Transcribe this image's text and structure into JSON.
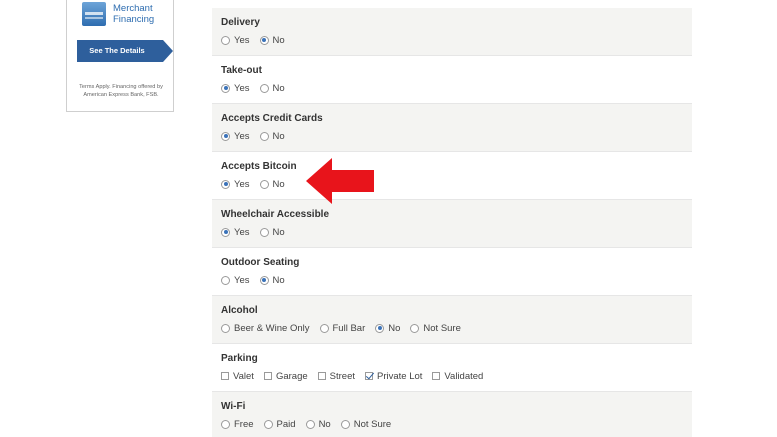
{
  "ad": {
    "brand": "Merchant",
    "brand2": "Financing",
    "cta": "See The Details",
    "terms": "Terms Apply. Financing offered by American Express Bank, FSB."
  },
  "form": {
    "rows": [
      {
        "label": "Delivery",
        "type": "radio",
        "options": [
          {
            "label": "Yes",
            "checked": false
          },
          {
            "label": "No",
            "checked": true
          }
        ]
      },
      {
        "label": "Take-out",
        "type": "radio",
        "options": [
          {
            "label": "Yes",
            "checked": true
          },
          {
            "label": "No",
            "checked": false
          }
        ]
      },
      {
        "label": "Accepts Credit Cards",
        "type": "radio",
        "options": [
          {
            "label": "Yes",
            "checked": true
          },
          {
            "label": "No",
            "checked": false
          }
        ]
      },
      {
        "label": "Accepts Bitcoin",
        "type": "radio",
        "options": [
          {
            "label": "Yes",
            "checked": true
          },
          {
            "label": "No",
            "checked": false
          }
        ]
      },
      {
        "label": "Wheelchair Accessible",
        "type": "radio",
        "options": [
          {
            "label": "Yes",
            "checked": true
          },
          {
            "label": "No",
            "checked": false
          }
        ]
      },
      {
        "label": "Outdoor Seating",
        "type": "radio",
        "options": [
          {
            "label": "Yes",
            "checked": false
          },
          {
            "label": "No",
            "checked": true
          }
        ]
      },
      {
        "label": "Alcohol",
        "type": "radio",
        "options": [
          {
            "label": "Beer & Wine Only",
            "checked": false
          },
          {
            "label": "Full Bar",
            "checked": false
          },
          {
            "label": "No",
            "checked": true
          },
          {
            "label": "Not Sure",
            "checked": false
          }
        ]
      },
      {
        "label": "Parking",
        "type": "checkbox",
        "options": [
          {
            "label": "Valet",
            "checked": false
          },
          {
            "label": "Garage",
            "checked": false
          },
          {
            "label": "Street",
            "checked": false
          },
          {
            "label": "Private Lot",
            "checked": true
          },
          {
            "label": "Validated",
            "checked": false
          }
        ]
      },
      {
        "label": "Wi-Fi",
        "type": "radio",
        "options": [
          {
            "label": "Free",
            "checked": false
          },
          {
            "label": "Paid",
            "checked": false
          },
          {
            "label": "No",
            "checked": false
          },
          {
            "label": "Not Sure",
            "checked": false
          }
        ]
      }
    ]
  },
  "annotation": {
    "arrow_color": "#e8141b",
    "arrow_points_to": "Accepts Bitcoin"
  },
  "colors": {
    "accent": "#3b73b9",
    "row_shade": "#f4f4f2"
  }
}
